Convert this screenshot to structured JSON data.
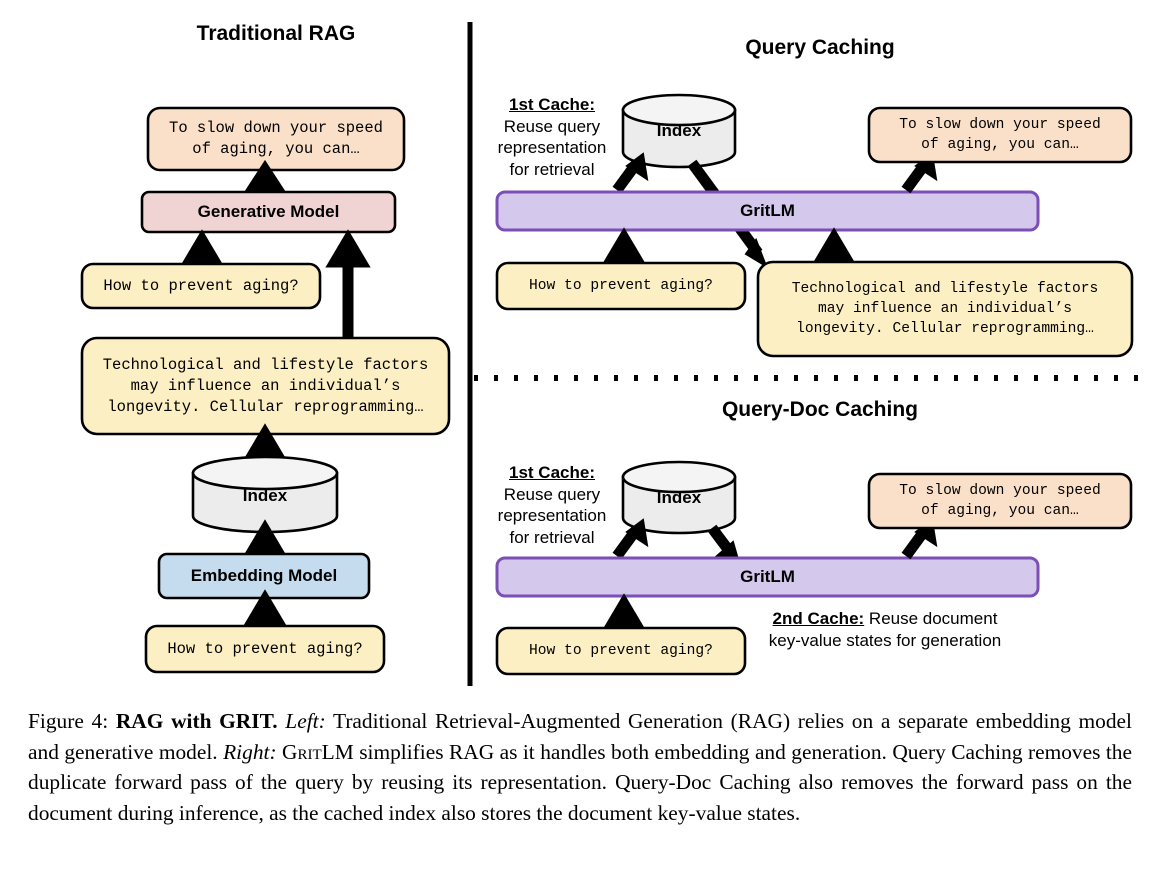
{
  "figure": {
    "panels": {
      "left": {
        "title": "Traditional RAG",
        "answer_box": "To slow down your speed\nof aging, you can…",
        "generative_model": "Generative Model",
        "query_top": "How to prevent aging?",
        "document_box": "Technological and lifestyle factors\nmay influence an individual’s\nlongevity. Cellular reprogramming…",
        "index": "Index",
        "embedding_model": "Embedding Model",
        "query_bottom": "How to prevent aging?"
      },
      "query_caching": {
        "title": "Query Caching",
        "cache_note_header": "1st Cache:",
        "cache_note_body": "Reuse query\nrepresentation\nfor retrieval",
        "index": "Index",
        "gritlm": "GritLM",
        "answer_box": "To slow down your speed\nof aging, you can…",
        "query_box": "How to prevent aging?",
        "document_box": "Technological and lifestyle factors\nmay influence an individual’s\nlongevity. Cellular reprogramming…"
      },
      "query_doc_caching": {
        "title": "Query-Doc Caching",
        "cache1_header": "1st Cache:",
        "cache1_body": "Reuse query\nrepresentation\nfor retrieval",
        "index": "Index",
        "gritlm": "GritLM",
        "answer_box": "To slow down your speed\nof aging, you can…",
        "query_box": "How to prevent aging?",
        "cache2_header": "2nd Cache:",
        "cache2_body": " Reuse document\nkey-value states for generation"
      }
    },
    "colors": {
      "answer_fill": "#fae0c8",
      "query_fill": "#fcefc4",
      "generative_fill": "#f0d3d3",
      "embedding_fill": "#c5dcee",
      "index_fill": "#ececec",
      "gritlm_fill": "#d4c9ec",
      "gritlm_stroke": "#7b4fb5",
      "stroke": "#000000"
    }
  },
  "caption": {
    "label": "Figure 4:",
    "bold_title": "RAG with GRIT.",
    "left_tag": "Left:",
    "left_text": "Traditional Retrieval-Augmented Generation (RAG) relies on a separate embedding model and generative model.",
    "right_tag": "Right:",
    "right_model": "GritLM",
    "right_text": "simplifies RAG as it handles both embedding and generation. Query Caching removes the duplicate forward pass of the query by reusing its representation. Query-Doc Caching also removes the forward pass on the document during inference, as the cached index also stores the document key-value states."
  }
}
